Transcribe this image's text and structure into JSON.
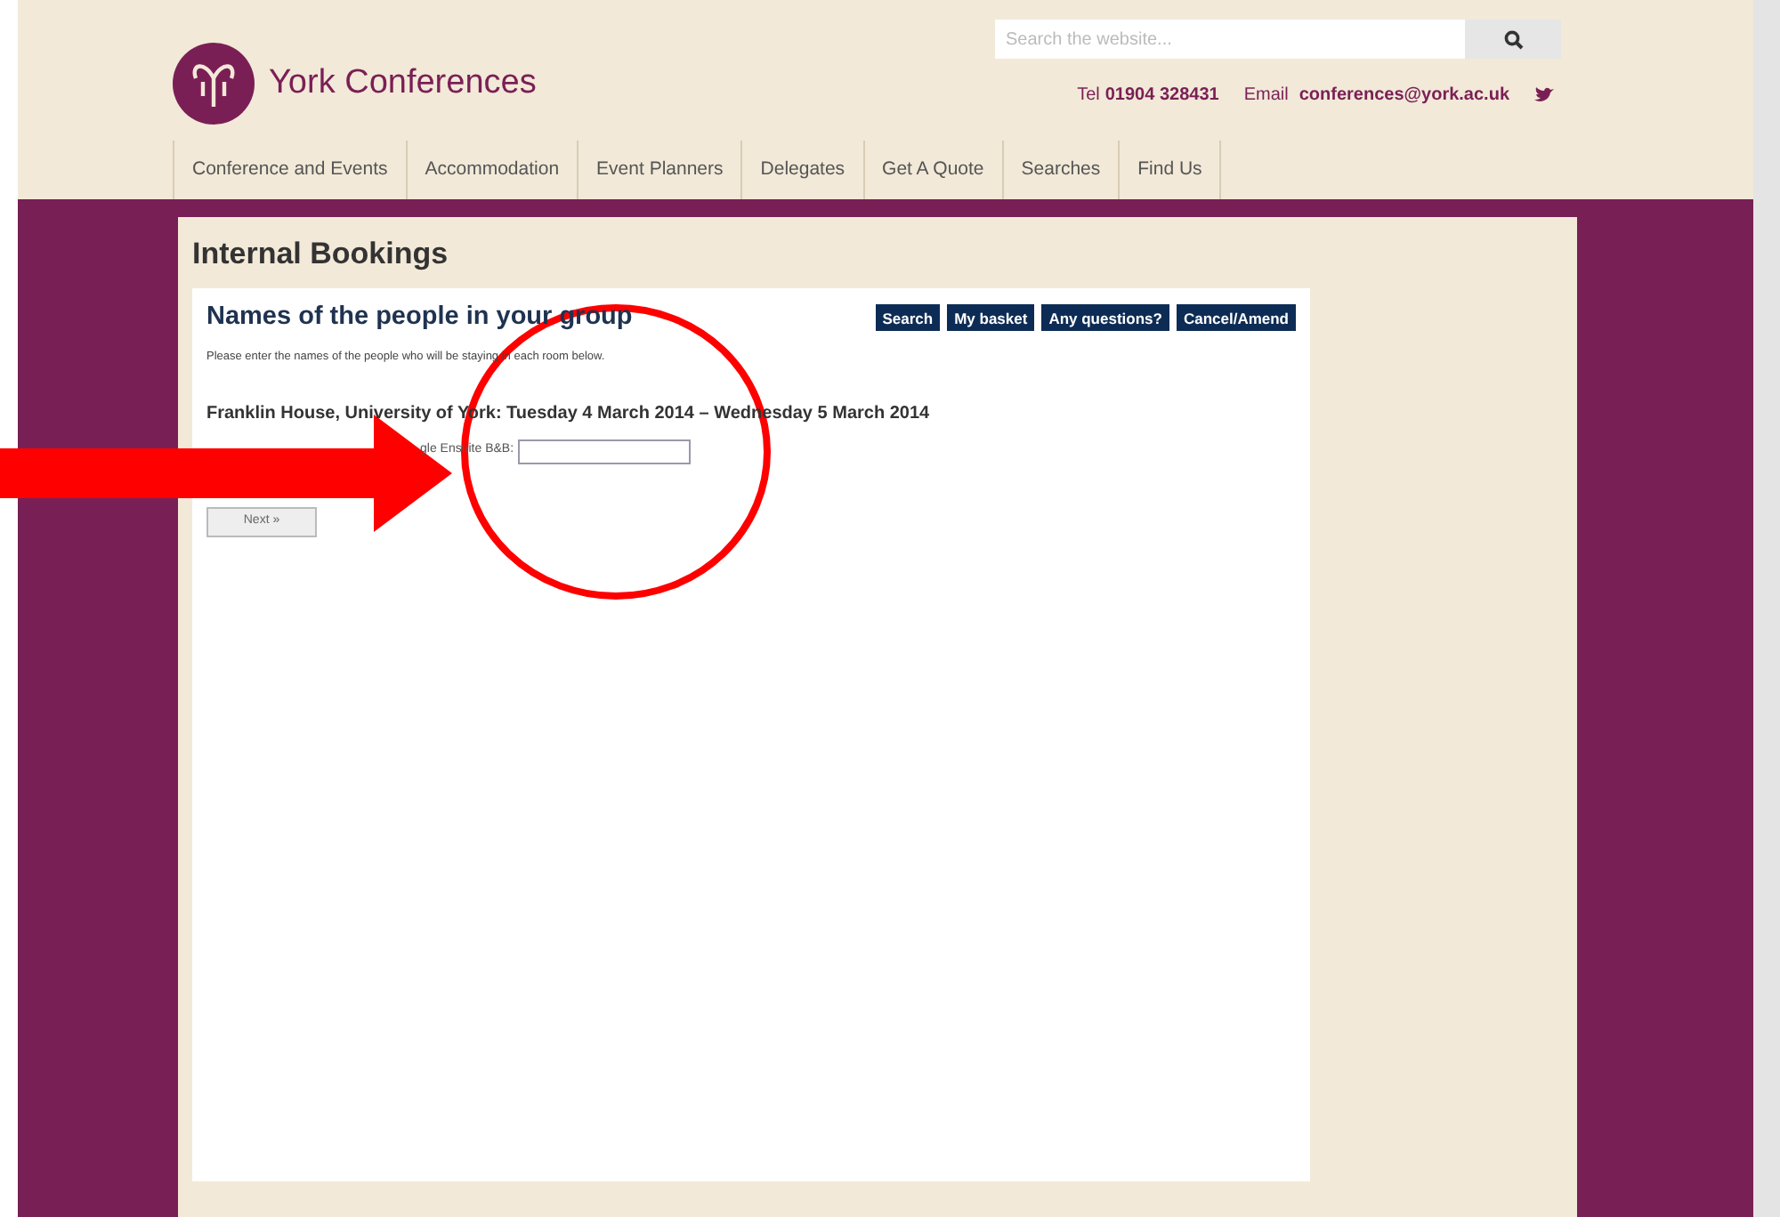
{
  "header": {
    "logo_text": "York Conferences",
    "search": {
      "placeholder": "Search the website..."
    },
    "tel_label": "Tel",
    "tel": "01904 328431",
    "email_label": "Email",
    "email": "conferences@york.ac.uk"
  },
  "nav": [
    {
      "label": "Conference and Events"
    },
    {
      "label": "Accommodation"
    },
    {
      "label": "Event Planners"
    },
    {
      "label": "Delegates"
    },
    {
      "label": "Get A Quote"
    },
    {
      "label": "Searches"
    },
    {
      "label": "Find Us"
    }
  ],
  "page_title": "Internal Bookings",
  "form": {
    "title": "Names of the people in your group",
    "actions": [
      "Search",
      "My basket",
      "Any questions?",
      "Cancel/Amend"
    ],
    "intro": "Please enter the names of the people who will be staying in each room below.",
    "booking": "Franklin House, University of York: Tuesday 4 March 2014 – Wednesday 5 March 2014",
    "room_label": "gle Ensuite B&B:",
    "next": "Next »"
  }
}
